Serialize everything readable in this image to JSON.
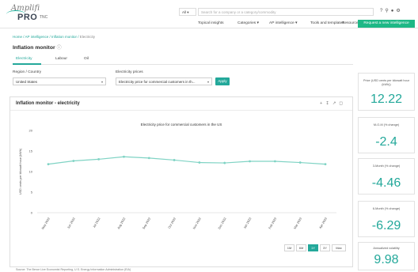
{
  "header": {
    "logo_top": "Amplifi",
    "logo_main": "PRO",
    "logo_suffix": "TNC",
    "search_scope": "All",
    "search_placeholder": "Search for a company or a category/commodity",
    "icons": [
      "help-icon",
      "search-icon",
      "user-icon",
      "settings-icon"
    ]
  },
  "nav": {
    "items": [
      "Topical insights",
      "Categories ▾",
      "AP intelligence ▾",
      "Tools and templates",
      "Resources ▾"
    ],
    "cta": "Request a new intelligence"
  },
  "breadcrumb": [
    "Home",
    "AP intelligence",
    "Inflation monitor",
    "Electricity"
  ],
  "page": {
    "title": "Inflation monitor"
  },
  "tabs": [
    "Electricity",
    "Labour",
    "Oil"
  ],
  "filters": {
    "region_label": "Region / Country",
    "region_value": "United States",
    "price_label": "Electricity prices",
    "price_value": "Electricity price for commercial customers in th...",
    "apply_label": "Apply"
  },
  "card": {
    "title": "Inflation monitor - electricity",
    "tools": [
      "add-icon",
      "download-icon",
      "share-icon",
      "expand-icon"
    ]
  },
  "chart_data": {
    "type": "line",
    "title": "Electricity price for commercial customers in the US",
    "ylabel": "USD cents per kilowatt hour (kWh)",
    "xlabel": "",
    "ylim": [
      0,
      20
    ],
    "yticks": [
      0,
      5,
      10,
      15,
      20
    ],
    "categories": [
      "May 2022",
      "Jun 2022",
      "Jul 2022",
      "Aug 2022",
      "Sep 2022",
      "Oct 2022",
      "Nov 2022",
      "Dec 2022",
      "Jan 2023",
      "Feb 2023",
      "Mar 2023",
      "Apr 2023"
    ],
    "series": [
      {
        "values": [
          11.8,
          12.6,
          13.0,
          13.6,
          13.3,
          12.8,
          12.2,
          12.1,
          12.5,
          12.5,
          12.2,
          11.8
        ]
      }
    ],
    "color": "#7fd3c4",
    "grid": false
  },
  "ranges": [
    "1M",
    "6M",
    "1Y",
    "3Y",
    "Max"
  ],
  "active_range": "1Y",
  "source": "Source: The Beroe Live Economist Reporting, U.S. Energy Information Administration (EIA)",
  "metrics": [
    {
      "label": "Price (USD cents per kilowatt hour (kWh))",
      "value": "12.22"
    },
    {
      "label": "M-O-M (% change)",
      "value": "-2.4"
    },
    {
      "label": "3-Month (% change)",
      "value": "-4.46"
    },
    {
      "label": "6-Month (% change)",
      "value": "-6.29"
    },
    {
      "label": "Annualized volatility",
      "value": "9.98"
    }
  ]
}
